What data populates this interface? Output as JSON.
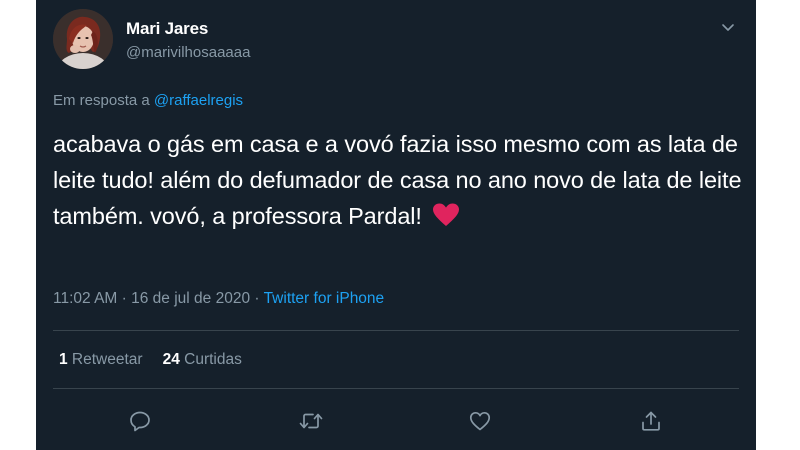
{
  "user": {
    "display_name": "Mari Jares",
    "handle": "@marivilhosaaaaa"
  },
  "reply": {
    "prefix": "Em resposta a ",
    "mention": "@raffaelregis"
  },
  "tweet": {
    "text": "acabava o gás em casa e a vovó fazia isso mesmo com as lata de leite tudo! além do defumador de casa no ano novo de lata de leite também. vovó, a professora Pardal!"
  },
  "meta": {
    "time": "11:02 AM",
    "separator1": " · ",
    "date": "16 de jul de 2020",
    "separator2": " · ",
    "source": "Twitter for iPhone"
  },
  "stats": {
    "retweets_count": "1",
    "retweets_label": " Retweetar",
    "likes_count": "24",
    "likes_label": " Curtidas"
  },
  "icons": {
    "caret": "chevron-down-icon",
    "reply": "reply-icon",
    "retweet": "retweet-icon",
    "like": "like-icon",
    "share": "share-icon",
    "emoji": "red-heart-emoji"
  },
  "colors": {
    "background": "#15202b",
    "text": "#ffffff",
    "secondary": "#8899a6",
    "link": "#1da1f2",
    "divider": "#38444d",
    "heart": "#e0245e"
  }
}
